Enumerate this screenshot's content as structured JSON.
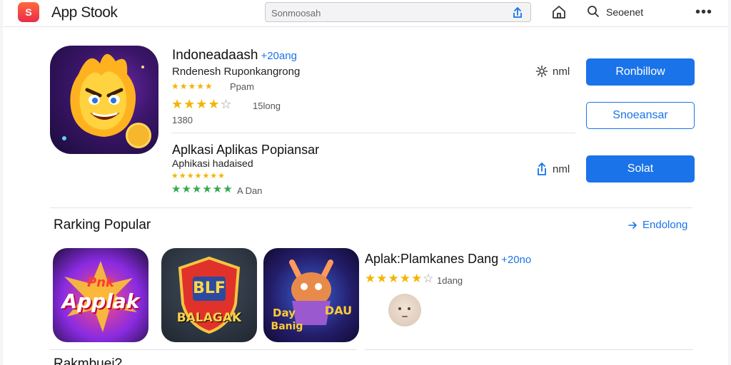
{
  "header": {
    "logo_glyph": "S",
    "title": "App Stook",
    "search_placeholder": "Sonmoosah",
    "search_label": "Seoenet",
    "more_glyph": "•••"
  },
  "featured": [
    {
      "name": "Indoneadaash",
      "tag": "+20ang",
      "subtitle": "Rndenesh Ruponkangrong",
      "rating_line": "Ppam",
      "rating_count": "15long",
      "size_text": "1380",
      "action_label": "nml",
      "primary_button": "Ronbillow",
      "secondary_button": "Snoeansar"
    },
    {
      "name": "Aplkasi Aplikas Popiansar",
      "subtitle": "Aphikasi hadaised",
      "rating_text": "A Dan",
      "action_label": "nml",
      "primary_button": "Solat"
    }
  ],
  "ranking": {
    "title": "Rarking Popular",
    "link_label": "Endolong",
    "tiles": [
      {
        "line1": "Pnk",
        "line2": "Applak"
      },
      {
        "line1": "BLF",
        "line2": "BALAGAK"
      },
      {
        "line1": "Day",
        "line2": "Banig",
        "line3": "DAU"
      }
    ],
    "detail": {
      "name": "Aplak:Plamkanes Dang",
      "tag": "+20no",
      "rating_count": "1dang"
    }
  },
  "cutoff_title": "Rakmbuei?",
  "colors": {
    "accent": "#1a73e8",
    "star": "#f4b400",
    "green_star": "#34a853"
  }
}
